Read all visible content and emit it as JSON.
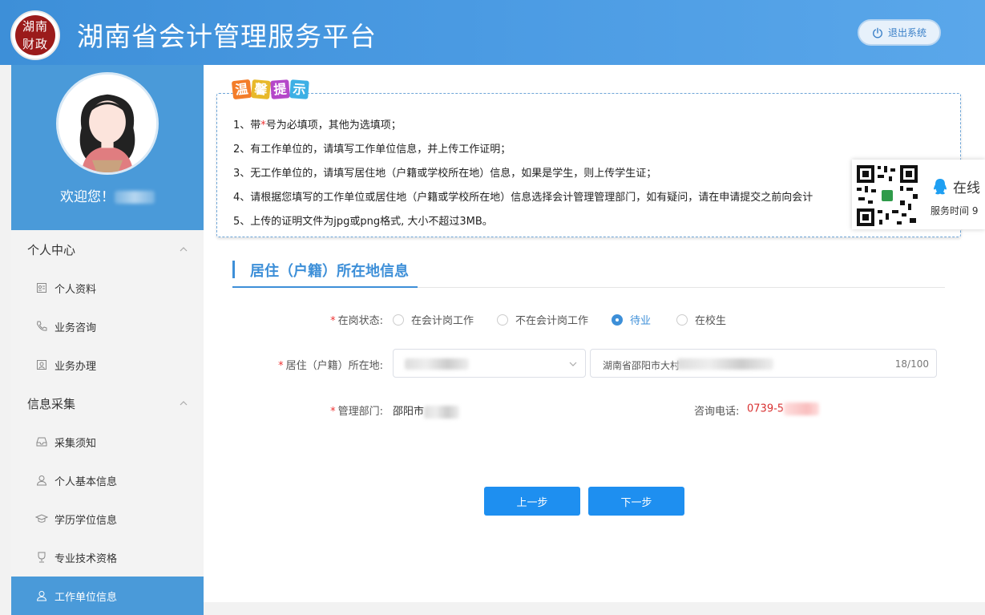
{
  "header": {
    "logo_text": "湖南\n财政",
    "title": "湖南省会计管理服务平台",
    "logout_label": "退出系统"
  },
  "profile": {
    "welcome_prefix": "欢迎您！"
  },
  "menu": {
    "groups": [
      {
        "title": "个人中心",
        "items": [
          "个人资料",
          "业务咨询",
          "业务办理"
        ]
      },
      {
        "title": "信息采集",
        "items": [
          "采集须知",
          "个人基本信息",
          "学历学位信息",
          "专业技术资格",
          "工作单位信息"
        ]
      }
    ],
    "active_item": "工作单位信息"
  },
  "tips": {
    "badge": [
      "温",
      "馨",
      "提",
      "示"
    ],
    "badge_colors": [
      "#f37d2a",
      "#e8b92a",
      "#b547c9",
      "#3db0e5"
    ],
    "line1_a": "1、带",
    "line1_star": "*",
    "line1_b": "号为必填项，其他为选填项；",
    "line2": "2、有工作单位的，请填写工作单位信息，并上传工作证明；",
    "line3": "3、无工作单位的，请填写居住地（户籍或学校所在地）信息，如果是学生，则上传学生证；",
    "line4": "4、请根据您填写的工作单位或居住地（户籍或学校所在地）信息选择会计管理管理部门，如有疑问，请在申请提交之前向会计",
    "line5": "5、上传的证明文件为jpg或png格式, 大小不超过3MB。"
  },
  "section": {
    "title": "居住（户籍）所在地信息"
  },
  "form": {
    "status_label": "在岗状态:",
    "status_options": [
      "在会计岗工作",
      "不在会计岗工作",
      "待业",
      "在校生"
    ],
    "status_selected": "待业",
    "residence_label": "居住（户籍）所在地:",
    "address_value": "湖南省邵阳市大村",
    "address_count": "18/100",
    "dept_label": "管理部门:",
    "dept_value": "邵阳市",
    "phone_label": "咨询电话:",
    "phone_value": "0739-5",
    "prev_button": "上一步",
    "next_button": "下一步"
  },
  "service": {
    "online_label": "在线",
    "time_label": "服务时间 9"
  },
  "colors": {
    "header": "#4494de",
    "accent": "#3d8fd8",
    "button": "#1e8ff0",
    "required": "#e33333"
  }
}
